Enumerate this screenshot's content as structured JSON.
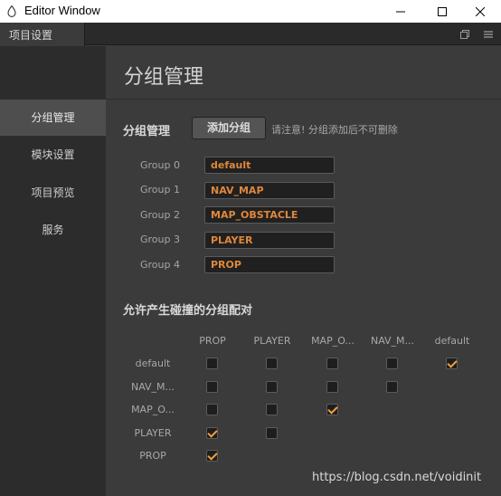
{
  "window": {
    "title": "Editor Window"
  },
  "tab": {
    "label": "项目设置"
  },
  "sidebar": {
    "items": [
      {
        "label": "分组管理",
        "active": true
      },
      {
        "label": "模块设置",
        "active": false
      },
      {
        "label": "项目预览",
        "active": false
      },
      {
        "label": "服务",
        "active": false
      }
    ]
  },
  "main": {
    "page_title": "分组管理",
    "groups_section_title": "分组管理",
    "add_button_label": "添加分组",
    "hint": "请注意! 分组添加后不可删除",
    "groups": [
      {
        "label": "Group 0",
        "value": "default"
      },
      {
        "label": "Group 1",
        "value": "NAV_MAP"
      },
      {
        "label": "Group 2",
        "value": "MAP_OBSTACLE"
      },
      {
        "label": "Group 3",
        "value": "PLAYER"
      },
      {
        "label": "Group 4",
        "value": "PROP"
      }
    ],
    "collision_section_title": "允许产生碰撞的分组配对",
    "matrix": {
      "columns": [
        "PROP",
        "PLAYER",
        "MAP_O...",
        "NAV_M...",
        "default"
      ],
      "rows": [
        {
          "label": "default",
          "checks": [
            false,
            false,
            false,
            false,
            true
          ]
        },
        {
          "label": "NAV_M...",
          "checks": [
            false,
            false,
            false,
            false
          ]
        },
        {
          "label": "MAP_O...",
          "checks": [
            false,
            false,
            true
          ]
        },
        {
          "label": "PLAYER",
          "checks": [
            true,
            false
          ]
        },
        {
          "label": "PROP",
          "checks": [
            true
          ]
        }
      ]
    }
  },
  "watermark": "https://blog.csdn.net/voidinit",
  "colors": {
    "accent": "#e0873a",
    "check": "#f0a03c",
    "background": "#3b3b3b",
    "sidebar": "#2c2c2c"
  },
  "icons": {
    "app": "droplet-icon",
    "minimize": "minimize-icon",
    "maximize": "maximize-icon",
    "close": "close-icon",
    "tab_restore": "restore-icon",
    "tab_menu": "menu-icon"
  }
}
